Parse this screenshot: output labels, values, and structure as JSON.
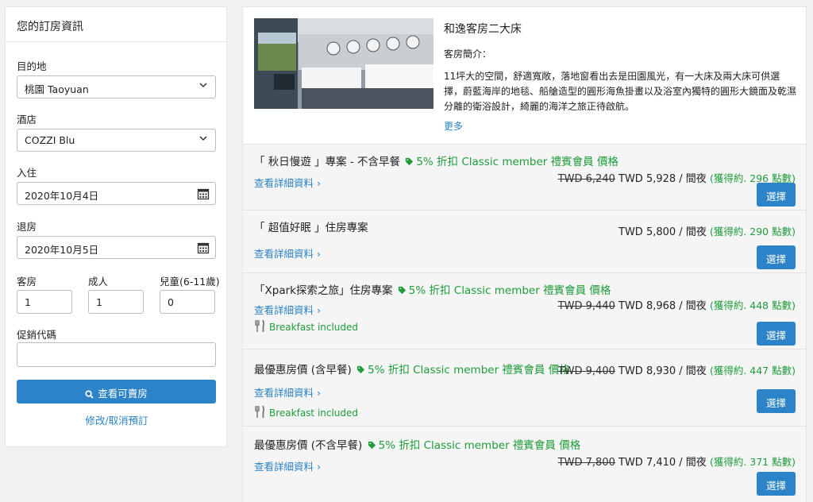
{
  "booking": {
    "title": "您的訂房資訊",
    "destination_label": "目的地",
    "destination_value": "桃園 Taoyuan",
    "hotel_label": "酒店",
    "hotel_value": "COZZI Blu",
    "checkin_label": "入住",
    "checkin_value": "2020年10月4日",
    "checkout_label": "退房",
    "checkout_value": "2020年10月5日",
    "rooms_label": "客房",
    "rooms_value": "1",
    "adults_label": "成人",
    "adults_value": "1",
    "children_label": "兒童(6-11歲)",
    "children_value": "0",
    "promo_label": "促銷代碼",
    "promo_value": "",
    "search_button": "查看可賣房",
    "manage_link": "修改/取消預訂"
  },
  "room": {
    "name": "和逸客房二大床",
    "intro_label": "客房簡介：",
    "description": "11坪大的空間，舒適寬敞，落地窗看出去是田園風光，有一大床及兩大床可供選擇，蔚藍海岸的地毯、船艙造型的圓形海魚掛畫以及浴室內獨特的圓形大鏡面及乾濕分離的衛浴設計，綺麗的海洋之旅正待啟航。",
    "more_link": "更多"
  },
  "common": {
    "detail_link": "查看詳細資料 ›",
    "select_button": "選擇",
    "breakfast": "Breakfast included"
  },
  "rates": [
    {
      "title": "「 秋日慢遊 」專案 - 不含早餐",
      "promo": "5% 折扣 Classic member 禮賓會員 價格",
      "old_price": "TWD 6,240",
      "price": " TWD 5,928 / 間夜 ",
      "points": "(獲得約. 296 點數)"
    },
    {
      "title": "「 超值好眠 」住房專案",
      "promo": "",
      "old_price": "",
      "price": "TWD 5,800 / 間夜 ",
      "points": "(獲得約. 290 點數)"
    },
    {
      "title": "「Xpark探索之旅」住房專案",
      "promo": "5% 折扣 Classic member 禮賓會員 價格",
      "old_price": "TWD 9,440",
      "price": " TWD 8,968 / 間夜 ",
      "points": "(獲得約. 448 點數)"
    },
    {
      "title": "最優惠房價 (含早餐)",
      "promo": "5% 折扣 Classic member 禮賓會員 價格",
      "old_price": "TWD 9,400",
      "price": " TWD 8,930 / 間夜 ",
      "points": "(獲得約. 447 點數)"
    },
    {
      "title": "最優惠房價 (不含早餐)",
      "promo": "5% 折扣 Classic member 禮賓會員 價格",
      "old_price": "TWD 7,800",
      "price": " TWD 7,410 / 間夜 ",
      "points": "(獲得約. 371 點數)"
    }
  ],
  "colors": {
    "accent": "#2c83c7",
    "promo_green": "#1e9c3a",
    "background": "#f2f2f2"
  }
}
